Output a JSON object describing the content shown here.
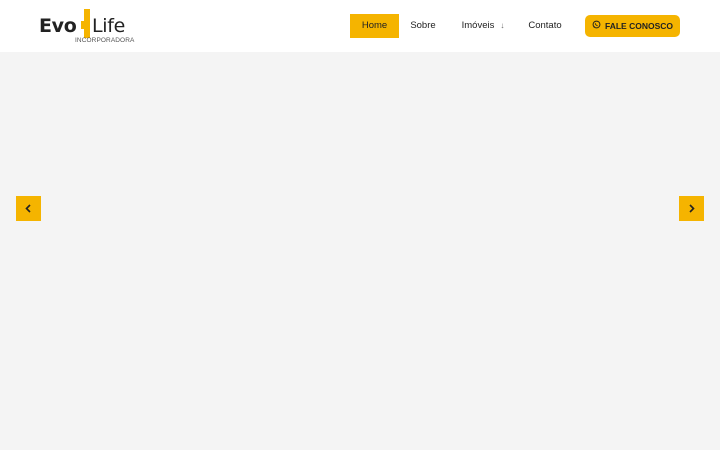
{
  "logo": {
    "main_left": "Evo",
    "main_right": "Life",
    "subtitle": "INCORPORADORA"
  },
  "nav": {
    "items": [
      {
        "label": "Home",
        "active": true
      },
      {
        "label": "Sobre"
      },
      {
        "label": "Imóveis",
        "has_dropdown": true,
        "dropdown_icon": "arrow-down-icon"
      },
      {
        "label": "Contato"
      }
    ]
  },
  "cta": {
    "label": "FALE CONOSCO",
    "icon": "whatsapp-icon"
  },
  "slider": {
    "prev_icon": "chevron-left-icon",
    "next_icon": "chevron-right-icon"
  },
  "colors": {
    "accent": "#f5b400",
    "page_background": "#f4f4f4",
    "header_background": "#ffffff",
    "text": "#222222"
  }
}
